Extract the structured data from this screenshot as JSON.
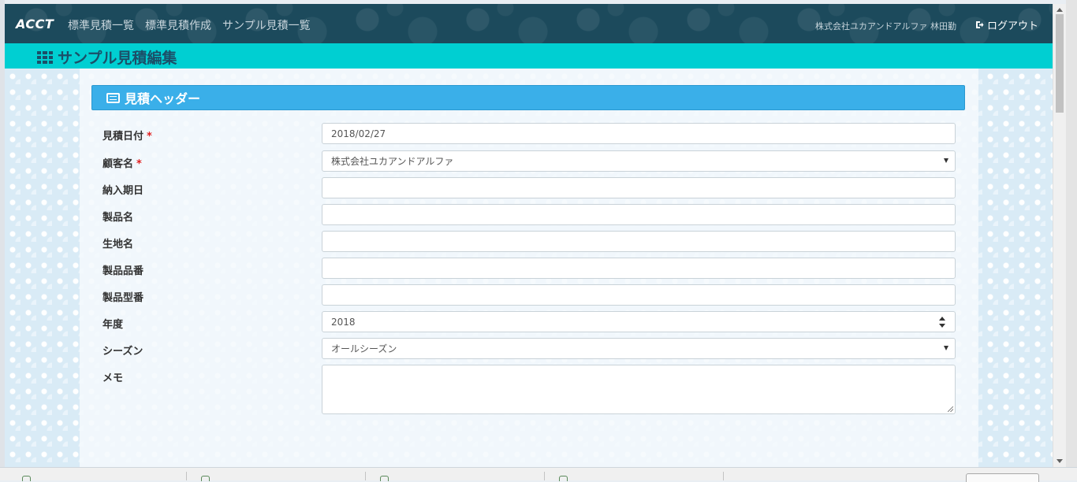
{
  "nav": {
    "brand": "ACCT",
    "links": [
      "標準見積一覧",
      "標準見積作成",
      "サンプル見積一覧"
    ],
    "user": "株式会社ユカアンドアルファ 林田勤",
    "logout": "ログアウト"
  },
  "page": {
    "title": "サンプル見積編集"
  },
  "panel": {
    "header": "見積ヘッダー"
  },
  "form": {
    "required_mark": "*",
    "fields": [
      {
        "label": "見積日付",
        "value": "2018/02/27",
        "type": "text",
        "required": true
      },
      {
        "label": "顧客名",
        "value": "株式会社ユカアンドアルファ",
        "type": "select",
        "required": true
      },
      {
        "label": "納入期日",
        "value": "",
        "type": "text",
        "required": false
      },
      {
        "label": "製品名",
        "value": "",
        "type": "text",
        "required": false
      },
      {
        "label": "生地名",
        "value": "",
        "type": "text",
        "required": false
      },
      {
        "label": "製品品番",
        "value": "",
        "type": "text",
        "required": false
      },
      {
        "label": "製品型番",
        "value": "",
        "type": "text",
        "required": false
      },
      {
        "label": "年度",
        "value": "2018",
        "type": "number",
        "required": false
      },
      {
        "label": "シーズン",
        "value": "オールシーズン",
        "type": "select",
        "required": false
      },
      {
        "label": "メモ",
        "value": "",
        "type": "textarea",
        "required": false
      }
    ]
  },
  "colors": {
    "nav_bg": "#1c4a5c",
    "title_bar": "#00cfd2",
    "panel_header": "#3aafe9",
    "required": "#e02020"
  }
}
